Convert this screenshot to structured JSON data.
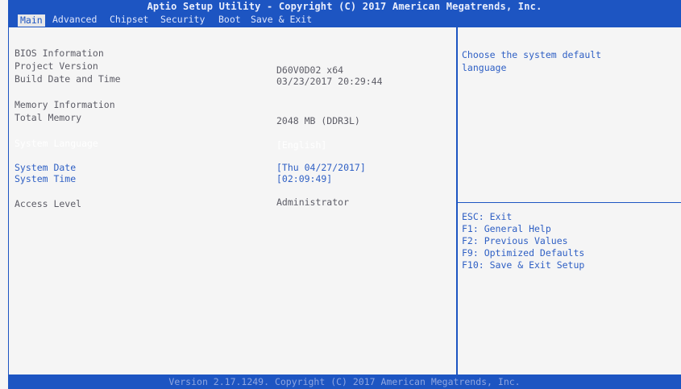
{
  "title": "Aptio Setup Utility - Copyright (C) 2017 American Megatrends, Inc.",
  "tabs": [
    {
      "label": "Main",
      "active": true
    },
    {
      "label": "Advanced",
      "active": false
    },
    {
      "label": "Chipset",
      "active": false
    },
    {
      "label": "Security",
      "active": false
    },
    {
      "label": "Boot",
      "active": false
    },
    {
      "label": "Save & Exit",
      "active": false
    }
  ],
  "main": {
    "bios_info_heading": "BIOS Information",
    "project_version_label": "Project Version",
    "project_version_value": "D60V0D02 x64",
    "build_date_label": "Build Date and Time",
    "build_date_value": "03/23/2017 20:29:44",
    "memory_info_heading": "Memory Information",
    "total_memory_label": "Total Memory",
    "total_memory_value": "2048 MB (DDR3L)",
    "system_language_label": "System Language",
    "system_language_value": "[English]",
    "system_date_label": "System Date",
    "system_date_value": "[Thu 04/27/2017]",
    "system_time_label": "System Time",
    "system_time_value": "[02:09:49]",
    "access_level_label": "Access Level",
    "access_level_value": "Administrator"
  },
  "help": {
    "line1": "Choose the system default",
    "line2": "language"
  },
  "keys": [
    "ESC: Exit",
    "F1: General Help",
    "F2: Previous Values",
    "F9: Optimized Defaults",
    "F10: Save & Exit Setup"
  ],
  "footer": "Version 2.17.1249. Copyright (C) 2017 American Megatrends, Inc.",
  "colors": {
    "bar_blue": "#1d55c2",
    "background": "#f5f5f5",
    "selectable_text": "#2e5fc4",
    "static_text": "#5c5c66"
  }
}
